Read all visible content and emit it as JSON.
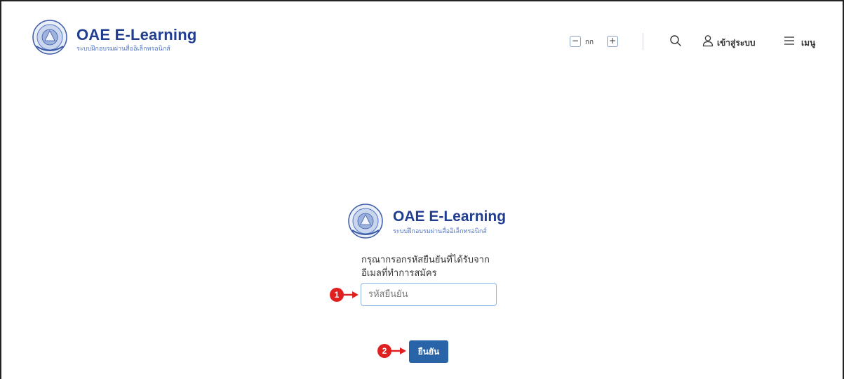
{
  "header": {
    "brand_title": "OAE E-Learning",
    "brand_subtitle": "ระบบฝึกอบรมผ่านสื่ออิเล็กทรอนิกส์",
    "font_size": {
      "decrease": "−",
      "label": "กก",
      "increase": "+"
    },
    "login_label": "เข้าสู่ระบบ",
    "menu_label": "เมนู",
    "icons": {
      "search": "search-icon",
      "user": "user-icon",
      "menu": "hamburger-icon",
      "logo": "oae-seal-logo"
    }
  },
  "verify": {
    "brand_title": "OAE E-Learning",
    "brand_subtitle": "ระบบฝึกอบรมผ่านสื่ออิเล็กทรอนิกส์",
    "instruction_line1": "กรุณากรอกรหัสยืนยันที่ได้รับจาก",
    "instruction_line2": "อีเมลที่ทำการสมัคร",
    "code_placeholder": "รหัสยืนยัน",
    "code_value": "",
    "confirm_label": "ยืนยัน"
  },
  "annotations": {
    "step1": "1",
    "step2": "2"
  },
  "colors": {
    "brand_navy": "#203d8f",
    "brand_blue": "#5377c4",
    "button": "#2a64a8",
    "marker_red": "#e02020"
  }
}
